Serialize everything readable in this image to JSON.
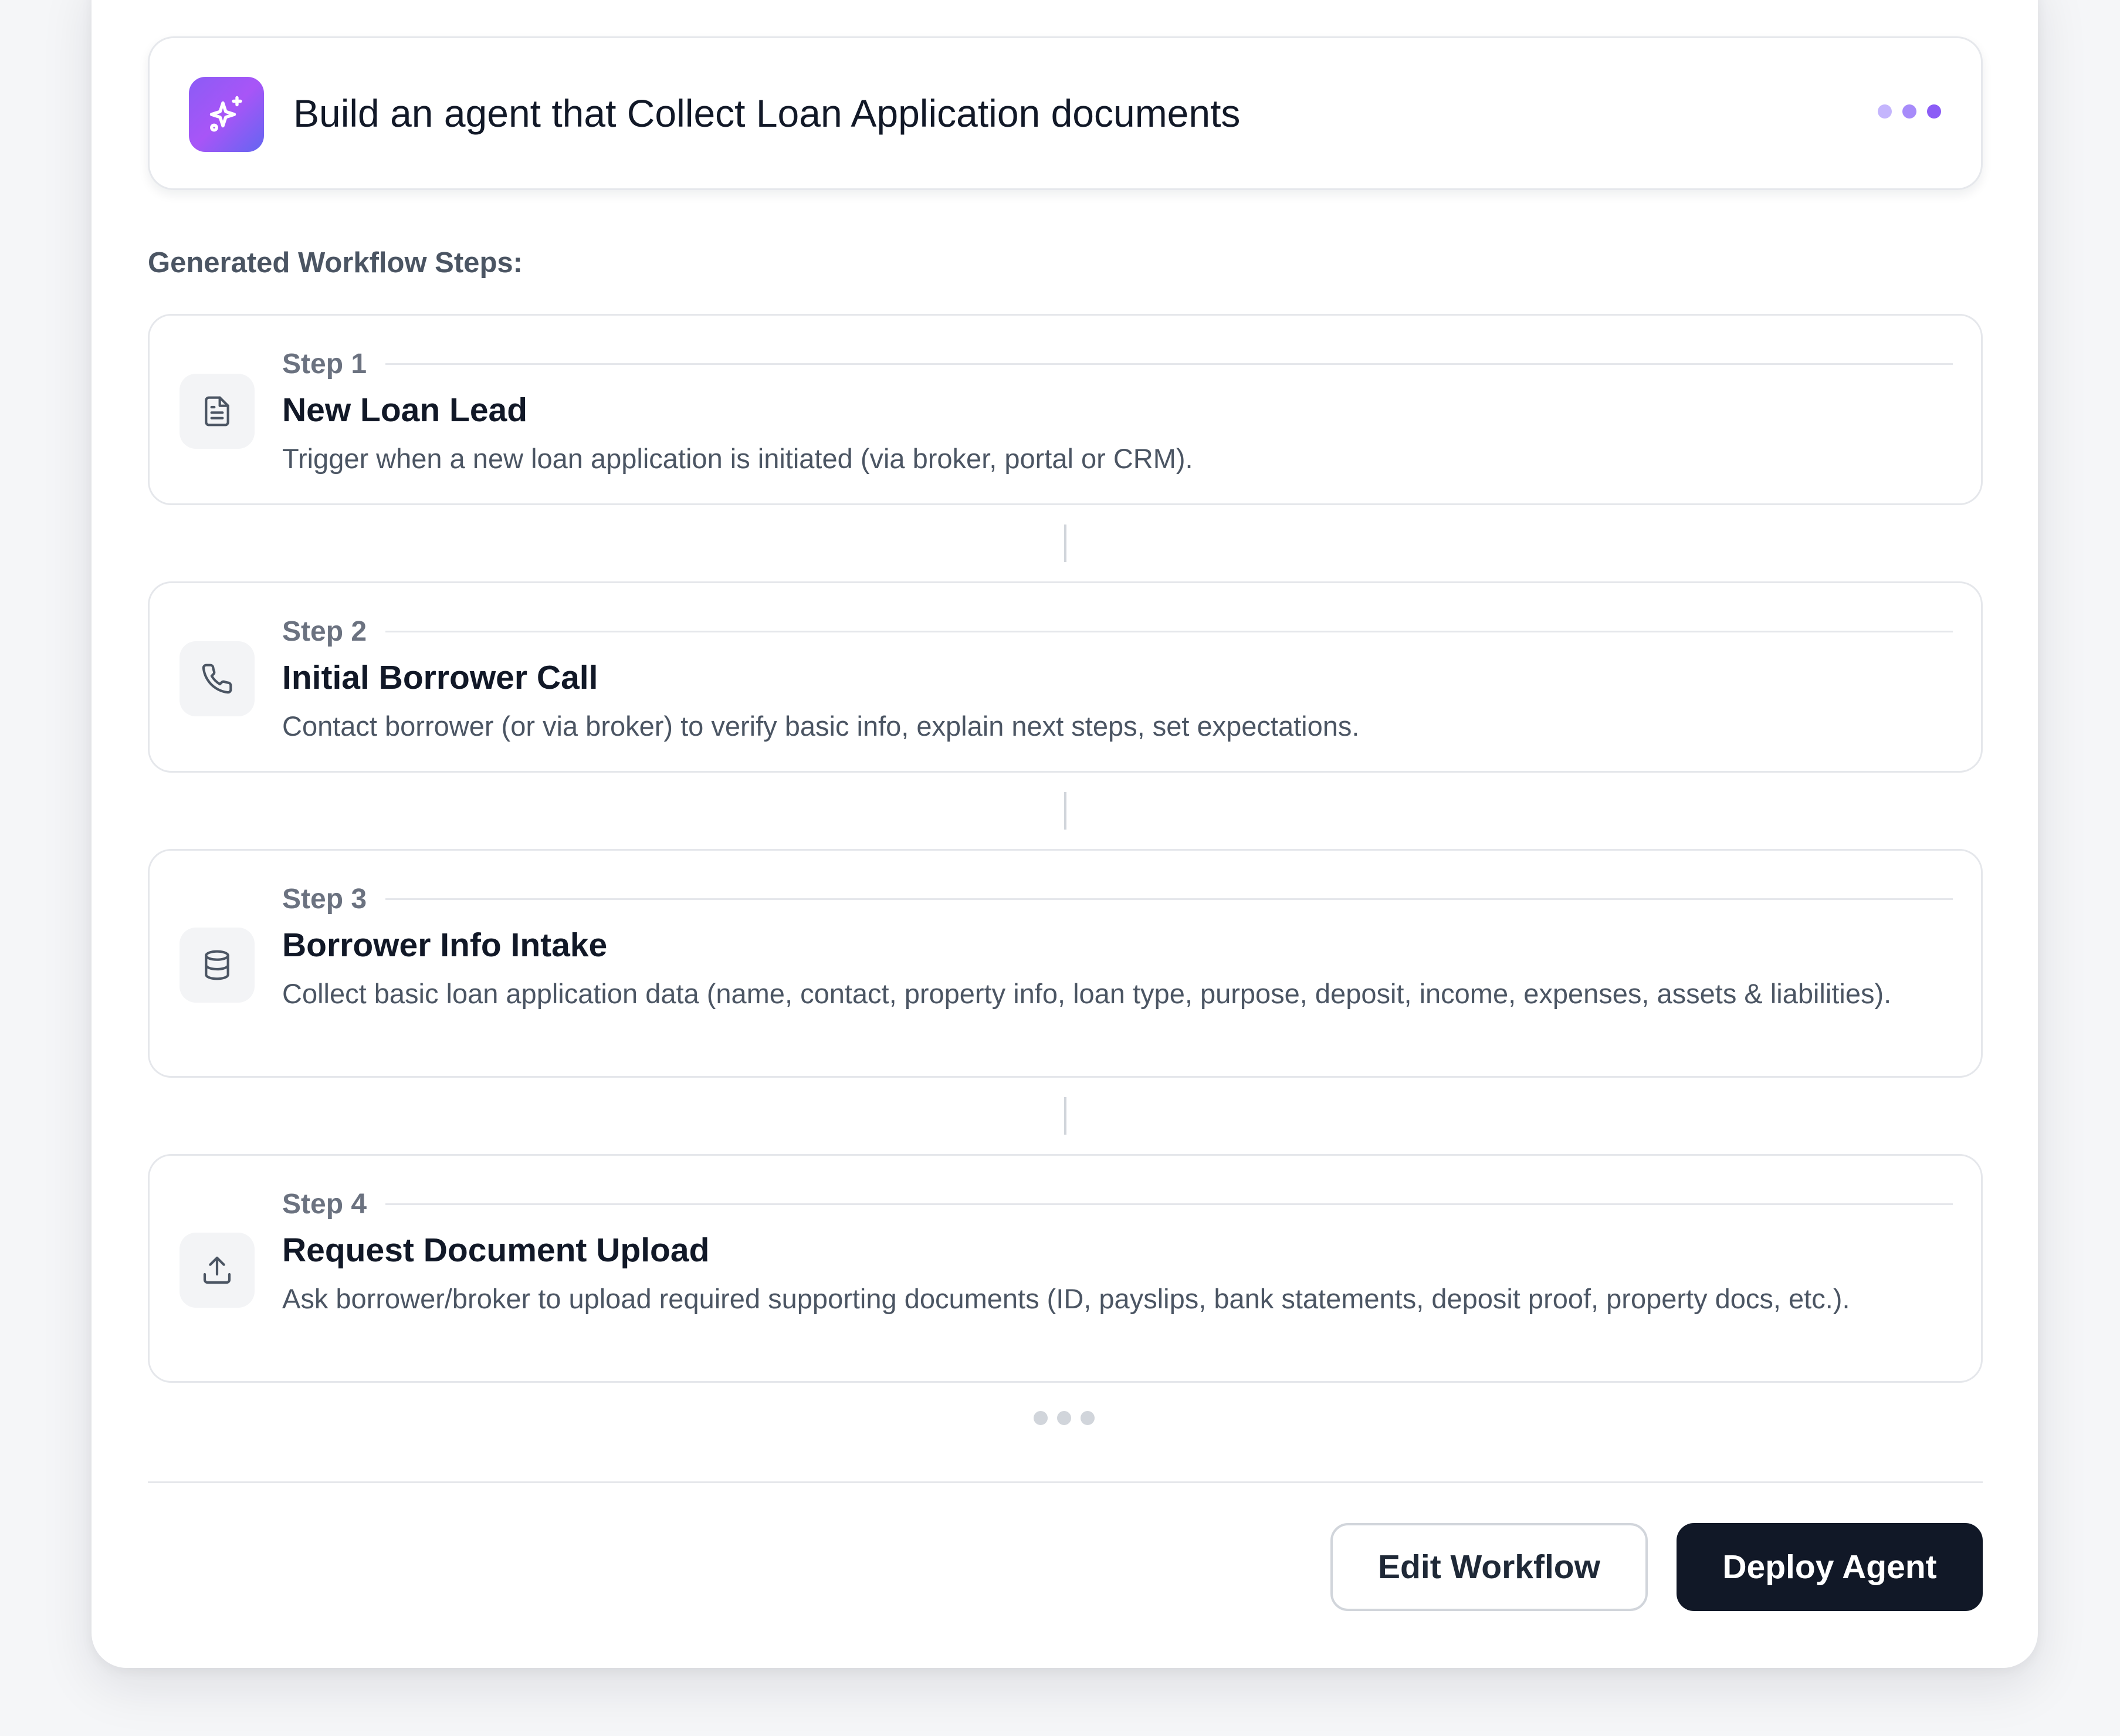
{
  "prompt": {
    "text": "Build an agent that Collect Loan Application documents",
    "icon": "sparkles-icon",
    "dots_colors": [
      "#c4b5fd",
      "#a78bfa",
      "#8b5cf6"
    ]
  },
  "workflow": {
    "section_label": "Generated Workflow Steps:",
    "steps": [
      {
        "label": "Step 1",
        "title": "New Loan Lead",
        "description": "Trigger when a new loan application is initiated (via broker, portal or CRM).",
        "icon": "document-icon"
      },
      {
        "label": "Step 2",
        "title": "Initial Borrower Call",
        "description": "Contact borrower (or via broker) to verify basic info, explain next steps, set expectations.",
        "icon": "phone-icon"
      },
      {
        "label": "Step 3",
        "title": "Borrower Info Intake",
        "description": "Collect basic loan application data (name, contact, property info, loan type, purpose, deposit, income, expenses, assets & liabilities).",
        "icon": "database-icon"
      },
      {
        "label": "Step 4",
        "title": "Request Document Upload",
        "description": "Ask borrower/broker to upload required supporting documents (ID, payslips, bank statements, deposit proof, property docs, etc.).",
        "icon": "upload-icon"
      }
    ]
  },
  "actions": {
    "edit_label": "Edit Workflow",
    "deploy_label": "Deploy Agent"
  },
  "colors": {
    "accent_gradient_start": "#8b5cf6",
    "accent_gradient_end": "#6366f1",
    "primary_button": "#111827",
    "muted_text": "#4b5563",
    "border": "#e5e7eb"
  }
}
